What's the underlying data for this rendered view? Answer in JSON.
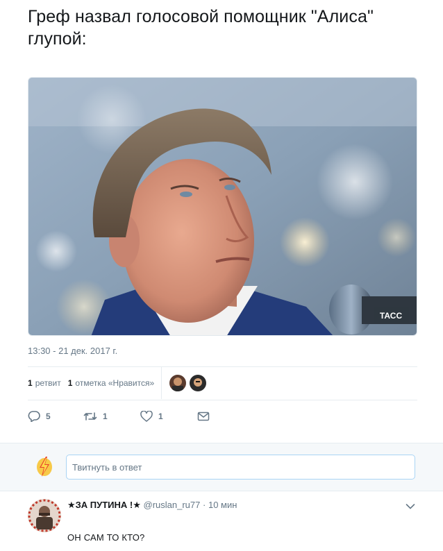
{
  "tweet": {
    "text": "Греф назвал голосовой помощник \"Алиса\" глупой:",
    "image_watermark": "ТАСС",
    "timestamp": "13:30 - 21 дек. 2017 г."
  },
  "stats": {
    "retweets_count": "1",
    "retweets_label": "ретвит",
    "likes_count": "1",
    "likes_label": "отметка «Нравится»"
  },
  "actions": {
    "replies": "5",
    "retweets": "1",
    "likes": "1"
  },
  "reply_box": {
    "placeholder": "Твитнуть в ответ"
  },
  "comment": {
    "display_name": "★ЗА ПУТИНА !★",
    "handle": "@ruslan_ru77",
    "separator": "·",
    "time": "10 мин",
    "text": "ОН САМ ТО КТО?"
  },
  "colors": {
    "accent": "#1da1f2",
    "muted": "#657786",
    "input_border": "#a9d4f5",
    "reply_bg": "#f5f8fa"
  }
}
